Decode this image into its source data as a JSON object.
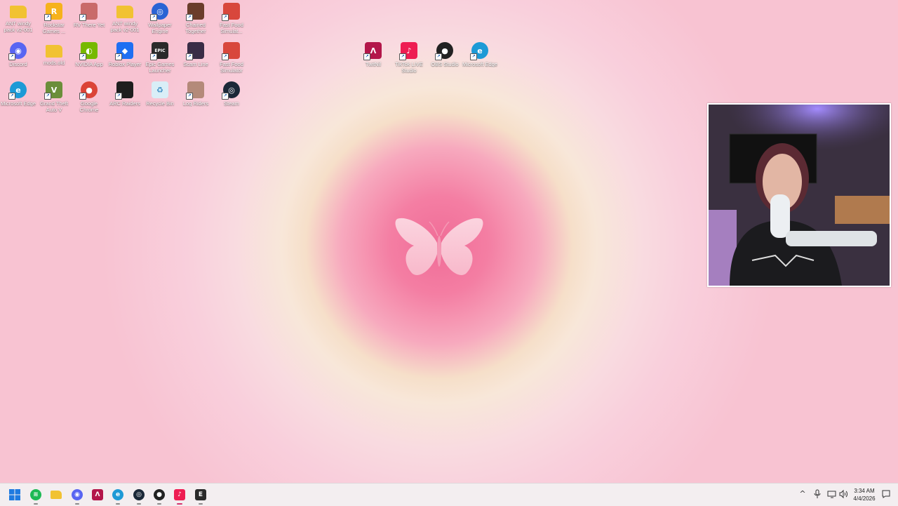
{
  "desktop": {
    "icons": [
      {
        "label": "ANT windy pack v2-001",
        "icon": "folder-icon",
        "color": "#f1c232"
      },
      {
        "label": "Rockstar Games ...",
        "icon": "rockstar-icon",
        "color": "#f6b21b"
      },
      {
        "label": "RV There Yet",
        "icon": "game-icon",
        "color": "#c96a6a"
      },
      {
        "label": "ANT windy pack v2-001",
        "icon": "folder-icon",
        "color": "#f1c232"
      },
      {
        "label": "Wallpaper Engine",
        "icon": "wallpaper-engine-icon",
        "color": "#2a63d4"
      },
      {
        "label": "Chained Together",
        "icon": "game-icon",
        "color": "#6b3d2b"
      },
      {
        "label": "Fast Food Simulat...",
        "icon": "game-icon",
        "color": "#d8473c"
      },
      {
        "label": "Discord",
        "icon": "discord-icon",
        "color": "#5865f2"
      },
      {
        "label": "mods.old",
        "icon": "folder-icon",
        "color": "#f1c232"
      },
      {
        "label": "NVIDIA App",
        "icon": "nvidia-icon",
        "color": "#76b900"
      },
      {
        "label": "Roblox Player",
        "icon": "roblox-icon",
        "color": "#1f6ff2"
      },
      {
        "label": "Epic Games Launcher",
        "icon": "epic-games-icon",
        "color": "#2a2a2a"
      },
      {
        "label": "Scam Line",
        "icon": "game-icon",
        "color": "#3a2d46"
      },
      {
        "label": "Fast Food Simulator",
        "icon": "game-icon",
        "color": "#d8473c"
      },
      {
        "label": "Microsoft Edge",
        "icon": "edge-icon",
        "color": "#1d9ad6"
      },
      {
        "label": "Grand Theft Auto V",
        "icon": "gta-icon",
        "color": "#6b8e3a"
      },
      {
        "label": "Google Chrome",
        "icon": "chrome-icon",
        "color": "#db4437"
      },
      {
        "label": "ARC Raiders",
        "icon": "game-icon",
        "color": "#1e1e1e"
      },
      {
        "label": "Recycle Bin",
        "icon": "recycle-bin-icon",
        "color": "#d9eef7"
      },
      {
        "label": "Log Riders",
        "icon": "game-icon",
        "color": "#b48a7a"
      },
      {
        "label": "Steam",
        "icon": "steam-icon",
        "color": "#1b2838"
      },
      {
        "label": "TwitNil",
        "icon": "streaming-icon",
        "color": "#b3164a"
      },
      {
        "label": "TikTok LIVE Studio",
        "icon": "tiktok-live-icon",
        "color": "#ee1d52"
      },
      {
        "label": "OBS Studio",
        "icon": "obs-icon",
        "color": "#222222"
      },
      {
        "label": "Microsoft Edge",
        "icon": "edge-icon",
        "color": "#1d9ad6"
      }
    ]
  },
  "webcam": {
    "description_icon": "webcam-overlay"
  },
  "taskbar": {
    "apps": [
      {
        "name": "start",
        "icon": "windows-start-icon",
        "color": "#1f7ae0",
        "glyph": ""
      },
      {
        "name": "spotify",
        "icon": "spotify-icon",
        "color": "#1db954",
        "glyph": "≋"
      },
      {
        "name": "file-explorer",
        "icon": "folder-icon",
        "color": "#f1c232",
        "glyph": ""
      },
      {
        "name": "discord",
        "icon": "discord-icon",
        "color": "#5865f2",
        "glyph": "◉"
      },
      {
        "name": "twitnil",
        "icon": "streaming-icon",
        "color": "#b3164a",
        "glyph": "Λ"
      },
      {
        "name": "edge",
        "icon": "edge-icon",
        "color": "#1d9ad6",
        "glyph": "e"
      },
      {
        "name": "steam",
        "icon": "steam-icon",
        "color": "#1b2838",
        "glyph": "◎"
      },
      {
        "name": "obs",
        "icon": "obs-icon",
        "color": "#222222",
        "glyph": "●"
      },
      {
        "name": "tiktok-live",
        "icon": "tiktok-live-icon",
        "color": "#ee1d52",
        "glyph": "♪"
      },
      {
        "name": "epic-games",
        "icon": "epic-games-icon",
        "color": "#2a2a2a",
        "glyph": "E"
      }
    ],
    "clock": {
      "time": "3:34 AM",
      "date": "4/4/2026"
    }
  },
  "colors": {
    "wallpaper": "#f8c3d2",
    "accent": "#d3336e"
  }
}
